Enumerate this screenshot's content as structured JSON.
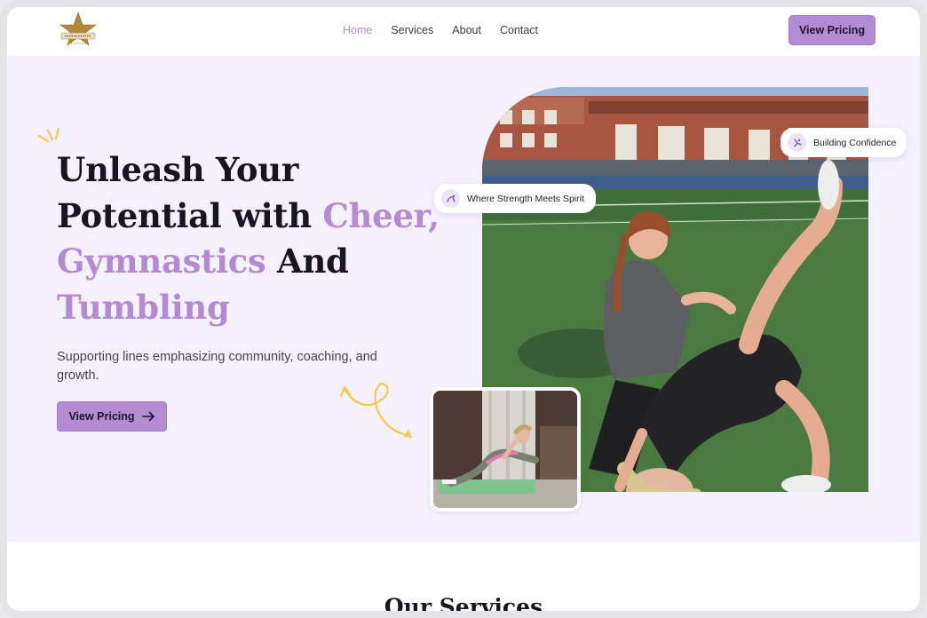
{
  "brand": {
    "logo_icon": "star-logo",
    "accent_color": "#b48ad2"
  },
  "nav": {
    "items": [
      {
        "label": "Home",
        "active": true
      },
      {
        "label": "Services",
        "active": false
      },
      {
        "label": "About",
        "active": false
      },
      {
        "label": "Contact",
        "active": false
      }
    ],
    "cta_label": "View Pricing"
  },
  "hero": {
    "headline": {
      "line1": "Unleash Your",
      "line2_plain": "Potential with ",
      "line2_accent": "Cheer,",
      "line3_accent": "Gymnastics",
      "line3_plain": " And",
      "line4_accent": "Tumbling"
    },
    "subtext": "Supporting lines emphasizing community, coaching, and growth.",
    "cta_label": "View Pricing",
    "cta_icon": "arrow-right-icon",
    "tags": [
      {
        "label": "Where Strength Meets Spirit",
        "icon": "gymnast-icon"
      },
      {
        "label": "Building Confidence",
        "icon": "tumbling-icon"
      }
    ]
  },
  "services": {
    "title": "Our Services"
  }
}
